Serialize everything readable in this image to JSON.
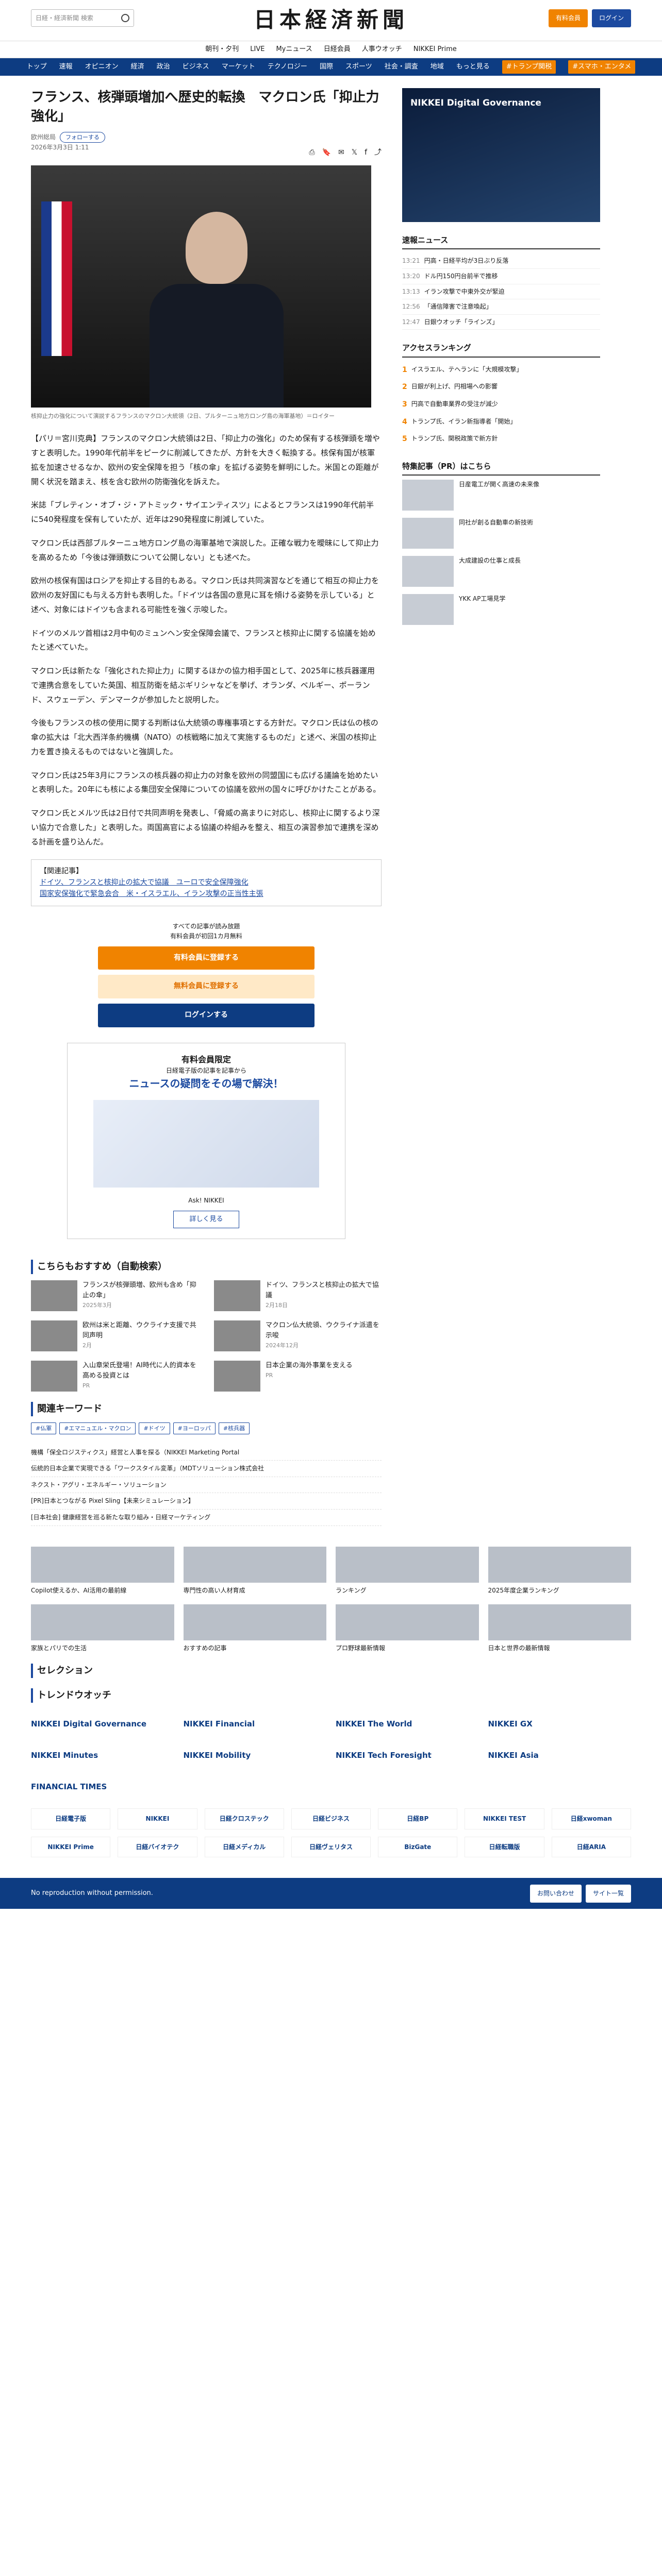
{
  "header": {
    "search_placeholder": "日経・経済新聞 検索",
    "logo": "日本経済新聞",
    "subscribe": "有料会員",
    "login": "ログイン"
  },
  "subnav": [
    "朝刊・夕刊",
    "LIVE",
    "Myニュース",
    "日経会員",
    "人事ウオッチ",
    "NIKKEI Prime"
  ],
  "mainnav": [
    "トップ",
    "速報",
    "オピニオン",
    "経済",
    "政治",
    "ビジネス",
    "マーケット",
    "テクノロジー",
    "国際",
    "スポーツ",
    "社会・調査",
    "地域",
    "もっと見る"
  ],
  "mainnav_pills": [
    "#トランプ関税",
    "#スマホ・エンタメ"
  ],
  "article": {
    "title": "フランス、核弾頭増加へ歴史的転換　マクロン氏「抑止力強化」",
    "author": "欧州総局",
    "follow": "フォローする",
    "date": "2026年3月3日 1:11",
    "caption": "核抑止力の強化について演説するフランスのマクロン大統領（2日、ブルターニュ地方ロング島の海軍基地）＝ロイター",
    "paras": [
      "【パリ＝宮川克典】フランスのマクロン大統領は2日、「抑止力の強化」のため保有する核弾頭を増やすと表明した。1990年代前半をピークに削減してきたが、方針を大きく転換する。核保有国が核軍拡を加速させるなか、欧州の安全保障を担う「核の傘」を拡げる姿勢を鮮明にした。米国との距離が開く状況を踏まえ、核を含む欧州の防衛強化を訴えた。",
      "米誌「ブレティン・オブ・ジ・アトミック・サイエンティスツ」によるとフランスは1990年代前半に540発程度を保有していたが、近年は290発程度に削減していた。",
      "マクロン氏は西部ブルターニュ地方ロング島の海軍基地で演説した。正確な戦力を曖昧にして抑止力を高めるため「今後は弾頭数について公開しない」とも述べた。",
      "欧州の核保有国はロシアを抑止する目的もある。マクロン氏は共同演習などを通じて相互の抑止力を欧州の友好国にも与える方針も表明した。「ドイツは各国の意見に耳を傾ける姿勢を示している」と述べ、対象にはドイツも含まれる可能性を強く示唆した。",
      "ドイツのメルツ首相は2月中旬のミュンヘン安全保障会議で、フランスと核抑止に関する協議を始めたと述べていた。",
      "マクロン氏は新たな「強化された抑止力」に関するほかの協力相手国として、2025年に核兵器運用で連携合意をしていた英国、相互防衛を結ぶギリシャなどを挙げ、オランダ、ベルギー、ポーランド、スウェーデン、デンマークが参加したと説明した。",
      "今後もフランスの核の使用に関する判断は仏大統領の専権事項とする方針だ。マクロン氏は仏の核の傘の拡大は「北大西洋条約機構（NATO）の核戦略に加えて実施するものだ」と述べ、米国の核抑止力を置き換えるものではないと強調した。",
      "マクロン氏は25年3月にフランスの核兵器の抑止力の対象を欧州の同盟国にも広げる議論を始めたいと表明した。20年にも核による集団安全保障についての協議を欧州の国々に呼びかけたことがある。",
      "マクロン氏とメルツ氏は2日付で共同声明を発表し、「脅威の高まりに対応し、核抑止に関するより深い協力で合意した」と表明した。両国高官による協議の枠組みを整え、相互の演習参加で連携を深める計画を盛り込んだ。"
    ],
    "related_title": "【関連記事】",
    "related": [
      "ドイツ、フランスと核抑止の拡大で協議　ユーロで安全保障強化",
      "国家安保強化で緊急会合　米・イスラエル、イラン攻撃の正当性主張"
    ]
  },
  "paywall": {
    "note": "すべての記事が読み放題",
    "note2": "有料会員が初回1カ月無料",
    "free": "有料会員に登録する",
    "paid": "無料会員に登録する",
    "login": "ログインする"
  },
  "promo": {
    "head": "有料会員限定",
    "sub": "日経電子版の記事を記事から",
    "title": "ニュースの疑問をその場で解決！",
    "ask": "Ask! NIKKEI",
    "more": "詳しく見る"
  },
  "recs_title": "こちらもおすすめ（自動検索）",
  "recs": [
    {
      "t": "フランスが核弾頭増、欧州も含め「抑止の傘」",
      "d": "2025年3月"
    },
    {
      "t": "ドイツ、フランスと核抑止の拡大で協議",
      "d": "2月18日"
    },
    {
      "t": "欧州は米と距離、ウクライナ支援で共同声明",
      "d": "2月"
    },
    {
      "t": "マクロン仏大統領、ウクライナ派遣を示唆",
      "d": "2024年12月"
    },
    {
      "t": "入山章栄氏登場！AI時代に人的資本を高める投資とは",
      "d": "PR"
    },
    {
      "t": "日本企業の海外事業を支える",
      "d": "PR"
    }
  ],
  "keywords_title": "関連キーワード",
  "keywords": [
    "#仏軍",
    "#エマニュエル・マクロン",
    "#ドイツ",
    "#ヨーロッパ",
    "#核兵器"
  ],
  "adlinks": [
    "機構「保全ロジスティクス」経営と人事を探る（NIKKEI Marketing Portal",
    "伝統的日本企業で実現できる「ワークスタイル変革」（MDTソリューション株式会社",
    "ネクスト・アグリ・エネルギー・ソリューション",
    "[PR]日本とつながる Pixel Sling【未来シミュレーション】",
    "[日本社会] 健康経営を巡る新たな取り組み・日経マーケティング"
  ],
  "side": {
    "ad": "NIKKEI Digital Governance",
    "news_title": "速報ニュース",
    "news": [
      {
        "t": "13:21",
        "x": "円高・日経平均が3日ぶり反落"
      },
      {
        "t": "13:20",
        "x": "ドル円150円台前半で推移"
      },
      {
        "t": "13:13",
        "x": "イラン攻撃で中東外交が緊迫"
      },
      {
        "t": "12:56",
        "x": "「通信障害で注意喚起」"
      },
      {
        "t": "12:47",
        "x": "日銀ウオッチ「ラインズ」"
      }
    ],
    "rank_title": "アクセスランキング",
    "rank": [
      "イスラエル、テヘランに「大規模攻撃」",
      "日銀が利上げ、円相場への影響",
      "円高で自動車業界の受注が減少",
      "トランプ氏、イラン新指導者「開始」",
      "トランプ氏、関税政策で新方針"
    ],
    "pr_title": "特集記事（PR）はこちら",
    "pr": [
      "日産電工が開く高速の未来像",
      "同社が創る自動車の新技術",
      "大成建設の仕事と成長",
      "YKK AP工場見学"
    ]
  },
  "lower": {
    "cards": [
      "Copilot使えるか、AI活用の最前線",
      "専門性の高い人材育成",
      "ランキング",
      "2025年度企業ランキング",
      "家族とパリでの生活",
      "おすすめの記事",
      "プロ野球最新情報",
      "日本と世界の最新情報"
    ],
    "selection": "セレクション",
    "trend": "トレンドウオッチ",
    "logos": [
      "NIKKEI Digital Governance",
      "NIKKEI Financial",
      "NIKKEI The World",
      "NIKKEI GX",
      "NIKKEI Minutes",
      "NIKKEI Mobility",
      "NIKKEI Tech Foresight",
      "NIKKEI Asia",
      "FINANCIAL TIMES"
    ],
    "minilogos": [
      "日経電子版",
      "NIKKEI",
      "日経クロステック",
      "日経ビジネス",
      "日経BP",
      "NIKKEI TEST",
      "日経xwoman",
      "NIKKEI Prime",
      "日経バイオテク",
      "日経メディカル",
      "日経ヴェリタス",
      "BizGate",
      "日経転職版",
      "日経ARIA"
    ],
    "copyright": "No reproduction without permission.",
    "help": "お問い合わせ",
    "list": "サイト一覧"
  }
}
